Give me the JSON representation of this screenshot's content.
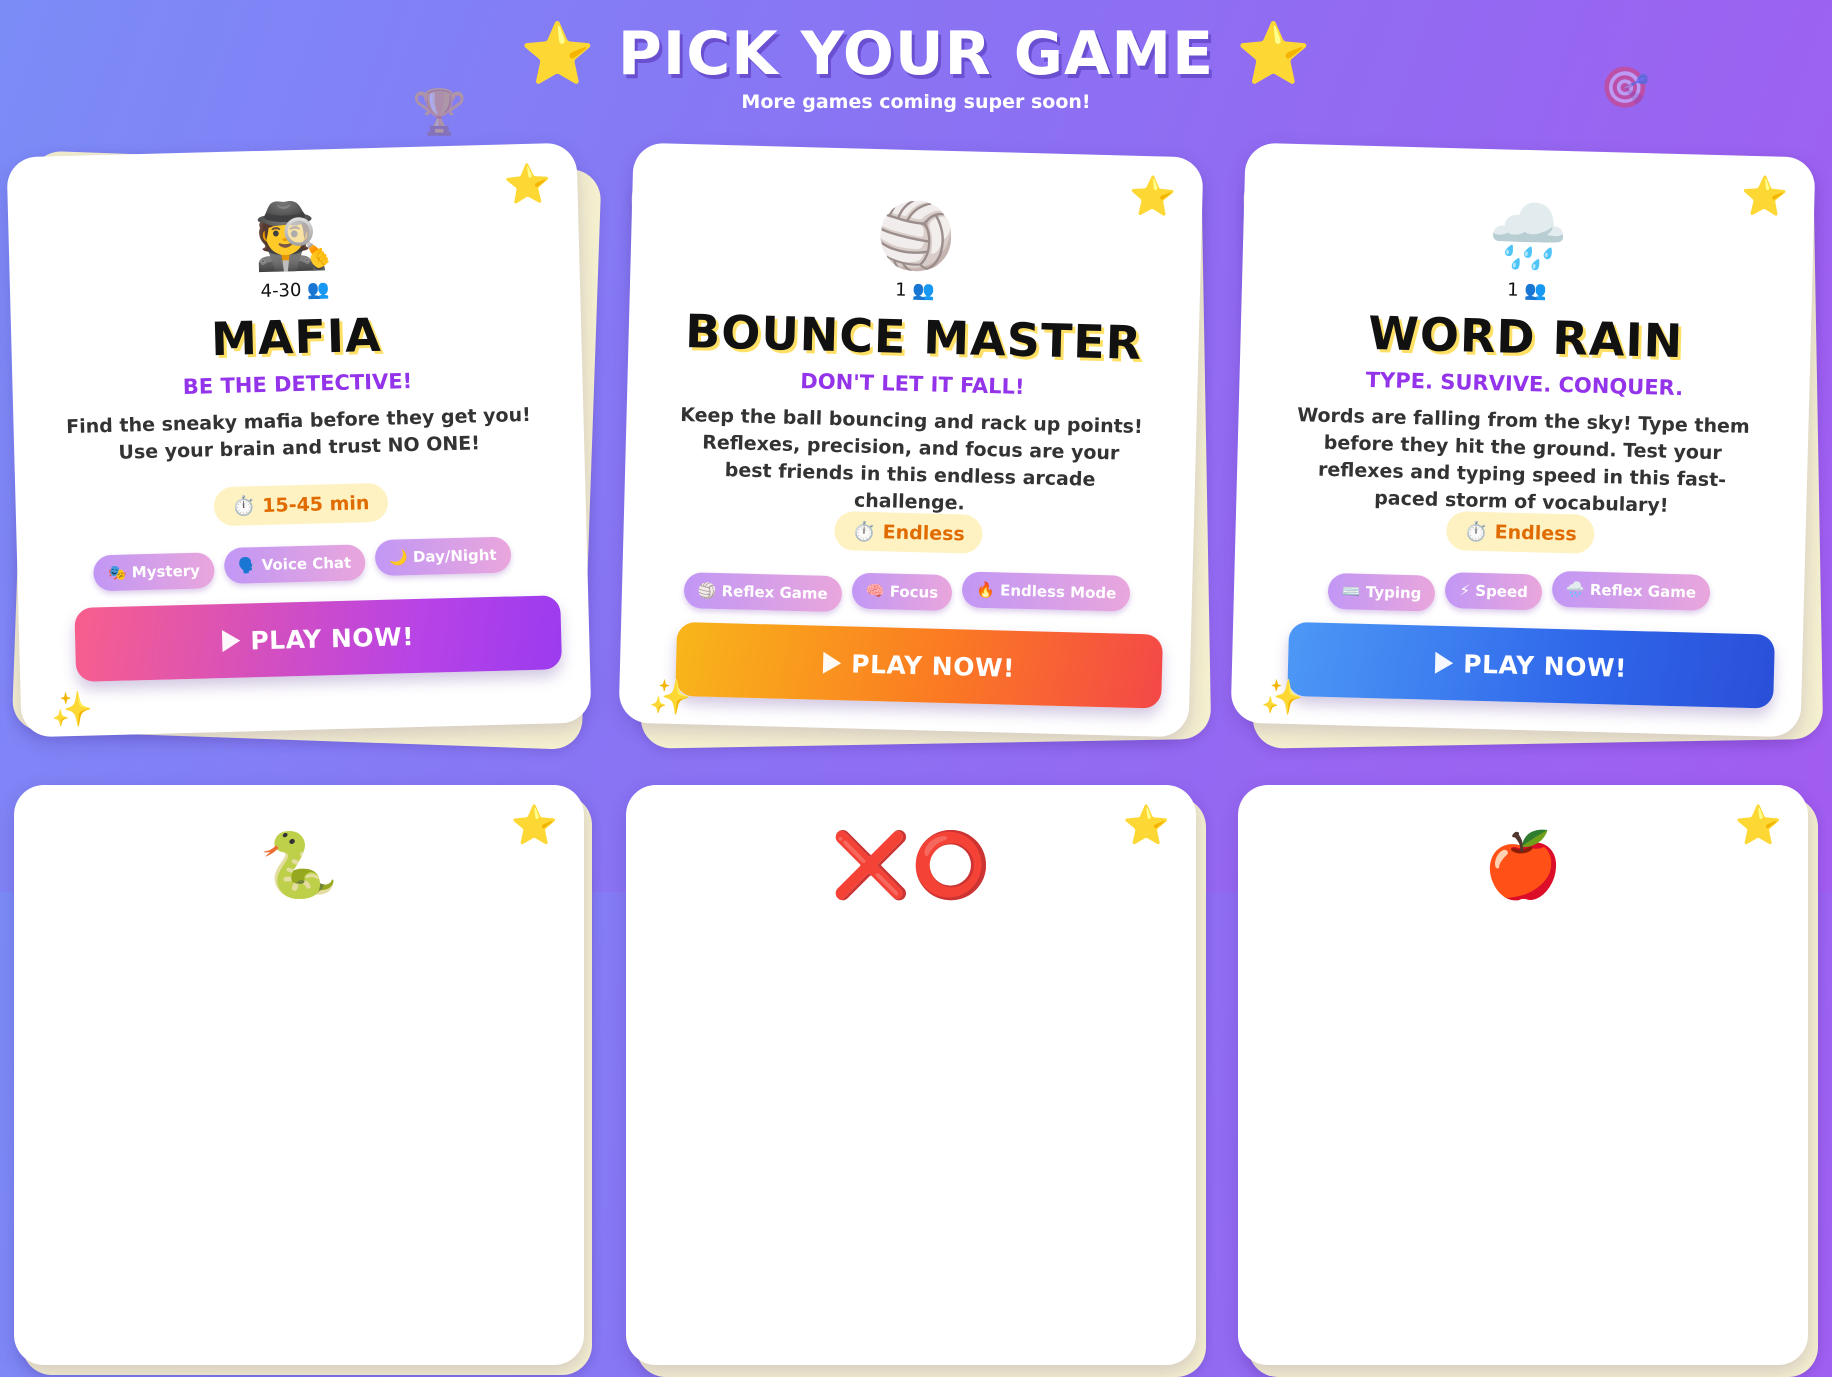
{
  "header": {
    "star_left": "⭐",
    "title": "PICK YOUR GAME",
    "star_right": "⭐",
    "subtitle": "More games coming super soon!"
  },
  "decorations": {
    "trophy": "🏆",
    "target": "🎯"
  },
  "cards": [
    {
      "emoji": "🕵️",
      "players": "4-30 👥",
      "name": "MAFIA",
      "tagline": "BE THE DETECTIVE!",
      "description": "Find the sneaky mafia before they get you! Use your brain and trust NO ONE!",
      "time": "⏱️ 15-45 min",
      "tags": [
        "🎭 Mystery",
        "🗣️ Voice Chat",
        "🌙 Day/Night"
      ],
      "button": "PLAY NOW!",
      "corner_star": "⭐",
      "sparkle": "✨"
    },
    {
      "emoji": "🏐",
      "players": "1 👥",
      "name": "BOUNCE MASTER",
      "tagline": "DON'T LET IT FALL!",
      "description": "Keep the ball bouncing and rack up points! Reflexes, precision, and focus are your best friends in this endless arcade challenge.",
      "time": "⏱️ Endless",
      "tags": [
        "🏐 Reflex Game",
        "🧠 Focus",
        "🔥 Endless Mode"
      ],
      "button": "PLAY NOW!",
      "corner_star": "⭐",
      "sparkle": "✨"
    },
    {
      "emoji": "🌧️",
      "players": "1 👥",
      "name": "WORD RAIN",
      "tagline": "TYPE. SURVIVE. CONQUER.",
      "description": "Words are falling from the sky! Type them before they hit the ground. Test your reflexes and typing speed in this fast-paced storm of vocabulary!",
      "time": "⏱️ Endless",
      "tags": [
        "⌨️ Typing",
        "⚡ Speed",
        "🌧️ Reflex Game"
      ],
      "button": "PLAY NOW!",
      "corner_star": "⭐",
      "sparkle": "✨"
    },
    {
      "emoji": "🐍",
      "corner_star": "⭐"
    },
    {
      "emoji": "❌⭕",
      "corner_star": "⭐"
    },
    {
      "emoji": "🍎",
      "corner_star": "⭐"
    }
  ],
  "colors": {
    "accent_purple": "#9333ea",
    "time_text": "#e06b00",
    "button_mafia": "#b843e6",
    "button_bounce": "#fb7a22",
    "button_word": "#2f67ea"
  }
}
